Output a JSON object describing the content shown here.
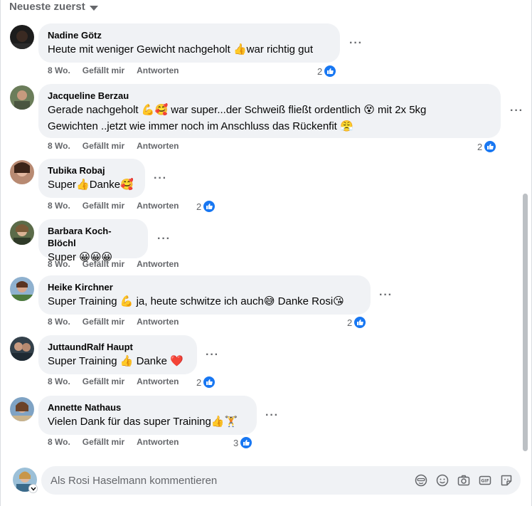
{
  "sort": {
    "label": "Neueste zuerst"
  },
  "comments": [
    {
      "author": "Nadine Götz",
      "text": "Heute mit weniger Gewicht nachgeholt 👍war richtig gut",
      "time": "8 Wo.",
      "like_label": "Gefällt mir",
      "reply_label": "Antworten",
      "reactions": "2"
    },
    {
      "author": "Jacqueline Berzau",
      "line1": "Gerade nachgeholt 💪🥰 war super...der Schweiß fließt ordentlich 😵 mit 2x 5kg",
      "line2": "Gewichten ..jetzt wie immer noch im Anschluss das Rückenfit 😤",
      "time": "8 Wo.",
      "like_label": "Gefällt mir",
      "reply_label": "Antworten",
      "reactions": "2"
    },
    {
      "author": "Tubika Robaj",
      "text": "Super👍Danke🥰",
      "time": "8 Wo.",
      "like_label": "Gefällt mir",
      "reply_label": "Antworten",
      "reactions": "2"
    },
    {
      "author": "Barbara Koch-Blöchl",
      "text": "Super 😀😀😀",
      "time": "8 Wo.",
      "like_label": "Gefällt mir",
      "reply_label": "Antworten",
      "reactions": ""
    },
    {
      "author": "Heike Kirchner",
      "text": "Super Training 💪 ja, heute schwitze ich auch😅 Danke Rosi😘",
      "time": "8 Wo.",
      "like_label": "Gefällt mir",
      "reply_label": "Antworten",
      "reactions": "2"
    },
    {
      "author": "JuttaundRalf Haupt",
      "text": "Super Training 👍 Danke ❤️",
      "time": "8 Wo.",
      "like_label": "Gefällt mir",
      "reply_label": "Antworten",
      "reactions": "2"
    },
    {
      "author": "Annette Nathaus",
      "text": "Vielen Dank für das super Training👍🏋",
      "time": "8 Wo.",
      "like_label": "Gefällt mir",
      "reply_label": "Antworten",
      "reactions": "3"
    }
  ],
  "composer": {
    "placeholder": "Als Rosi Haselmann kommentieren"
  },
  "icons": {
    "reaction": "like-icon",
    "composer": [
      "avatar-sticker-icon",
      "emoji-icon",
      "camera-icon",
      "gif-icon",
      "sticker-icon"
    ]
  },
  "colors": {
    "accent": "#1877f2",
    "bubble": "#f0f2f5",
    "meta": "#65676b"
  }
}
